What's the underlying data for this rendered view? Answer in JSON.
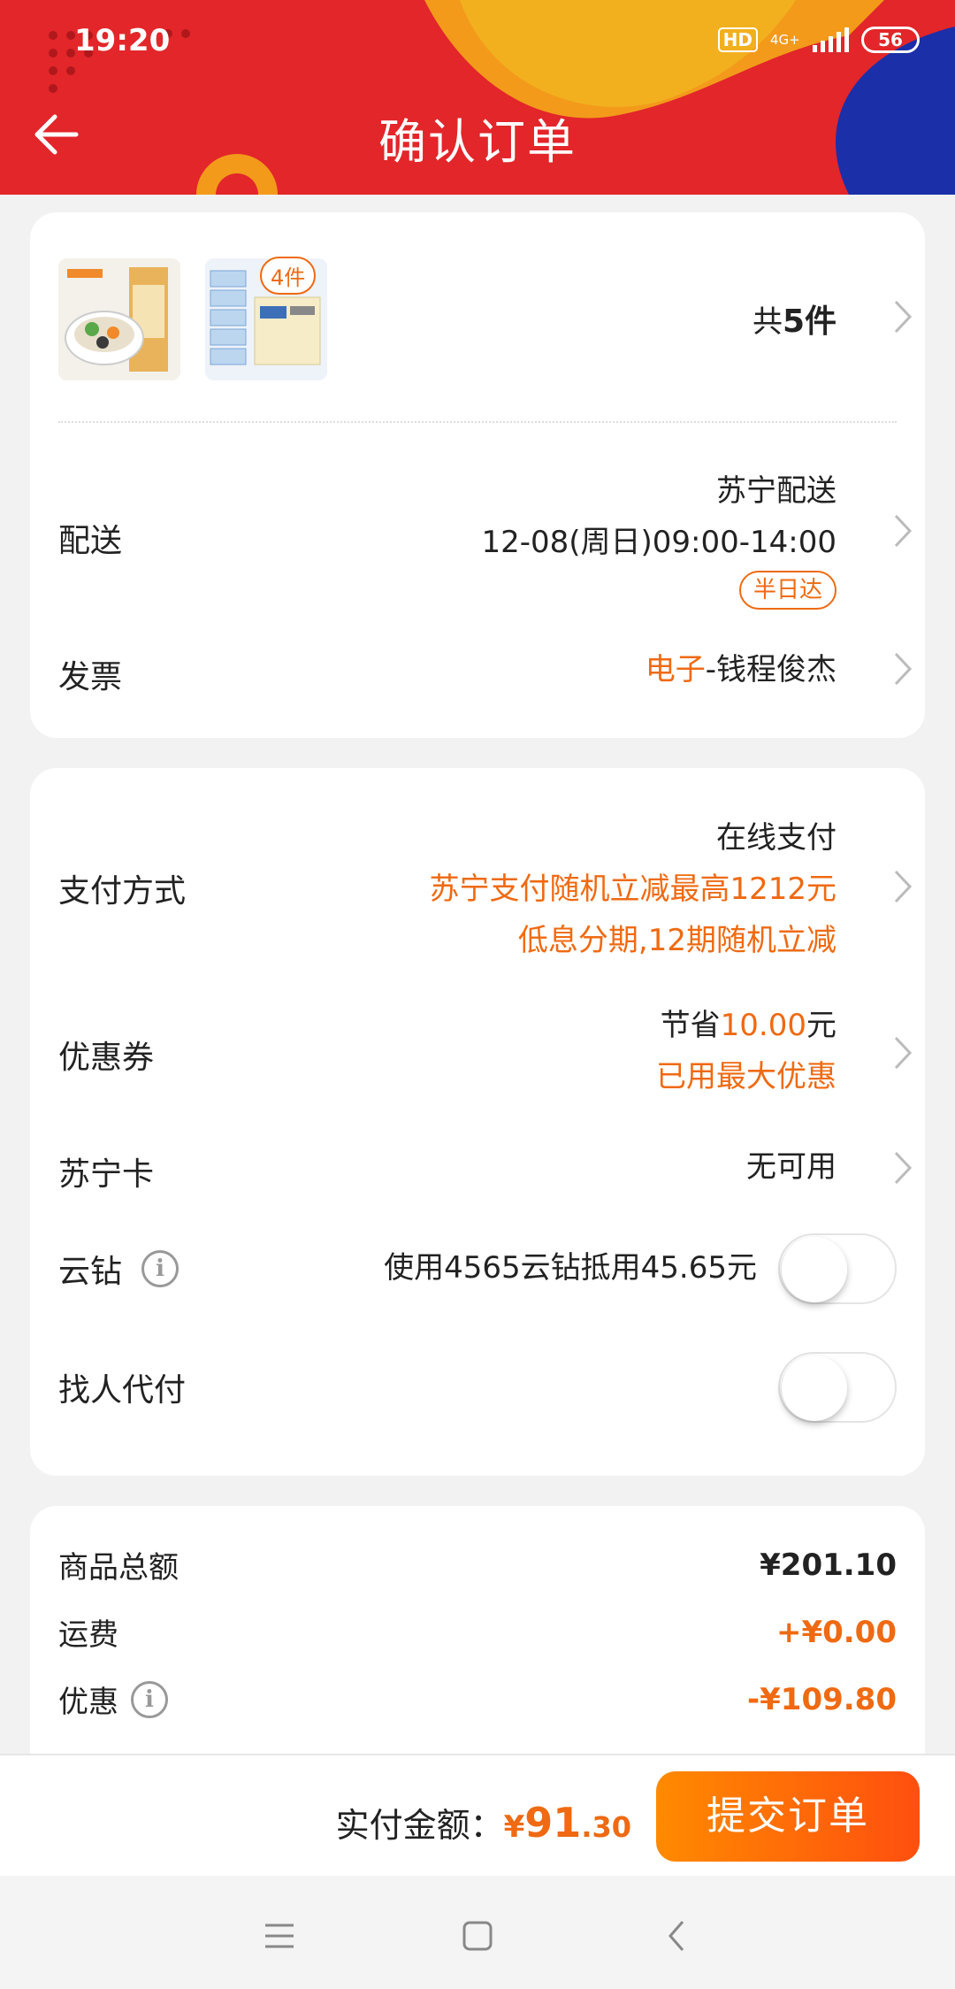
{
  "status": {
    "time": "19:20",
    "hd": "HD",
    "net": "4G+",
    "battery": "56"
  },
  "header": {
    "title": "确认订单",
    "back_icon": "arrow-left-icon"
  },
  "products": {
    "count_badge": "4件",
    "total_prefix": "共",
    "total_number": "5件"
  },
  "delivery": {
    "label": "配送",
    "carrier": "苏宁配送",
    "time": "12-08(周日)09:00-14:00",
    "tag": "半日达"
  },
  "invoice": {
    "label": "发票",
    "type": "电子",
    "name": "-钱程俊杰"
  },
  "payment": {
    "label": "支付方式",
    "method": "在线支付",
    "promo1": "苏宁支付随机立减最高1212元",
    "promo2": "低息分期,12期随机立减"
  },
  "coupon": {
    "label": "优惠券",
    "save_prefix": "节省",
    "save_amount": "10.00",
    "save_suffix": "元",
    "status": "已用最大优惠"
  },
  "suning_card": {
    "label": "苏宁卡",
    "value": "无可用"
  },
  "cloud_diamond": {
    "label": "云钻",
    "text": "使用4565云钻抵用45.65元",
    "enabled": false
  },
  "pay_for_me": {
    "label": "找人代付",
    "enabled": false
  },
  "summary": {
    "goods_label": "商品总额",
    "goods_value": "¥201.10",
    "shipping_label": "运费",
    "shipping_value": "+¥0.00",
    "discount_label": "优惠",
    "discount_value": "-¥109.80"
  },
  "footer": {
    "pay_label": "实付金额：",
    "yen": "¥",
    "amount_int": "91",
    "amount_dec": ".30",
    "submit": "提交订单"
  },
  "colors": {
    "accent": "#ef6a12",
    "header_red": "#e2262a",
    "submit_start": "#ff8a00",
    "submit_end": "#ff4f0f"
  }
}
